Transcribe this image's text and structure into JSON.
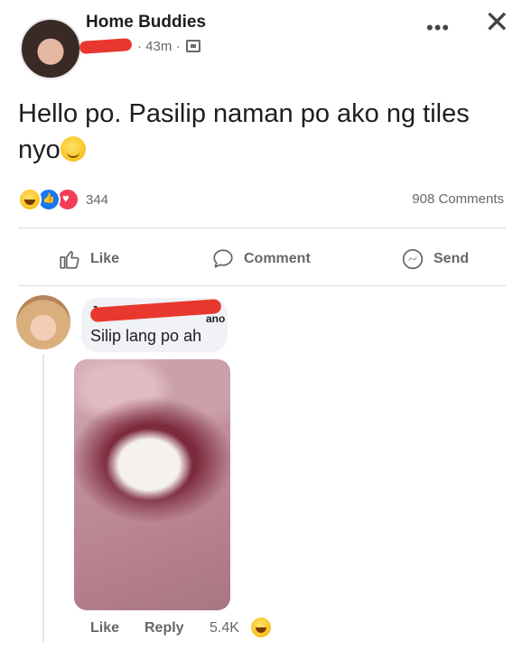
{
  "post": {
    "group_name": "Home Buddies",
    "time": "· 43m ·",
    "text": "Hello po. Pasilip naman po ako ng tiles nyo",
    "text_emoji": "smiling-face-with-smiling-eyes"
  },
  "header": {
    "more_glyph": "•••",
    "close_glyph": "✕"
  },
  "stats": {
    "reaction_count": "344",
    "comment_count": "908 Comments",
    "reaction_icons": [
      "haha",
      "like",
      "love"
    ]
  },
  "actions": {
    "like_label": "Like",
    "comment_label": "Comment",
    "send_label": "Send"
  },
  "comment": {
    "author_initial": "J",
    "author_tail": "ano",
    "text": "Silip lang po ah",
    "like_label": "Like",
    "reply_label": "Reply",
    "reaction_count": "5.4K",
    "reaction_icon": "haha"
  },
  "colors": {
    "redaction": "#e8372e",
    "bubble": "#f0f2f5",
    "secondary_text": "#65676b"
  }
}
